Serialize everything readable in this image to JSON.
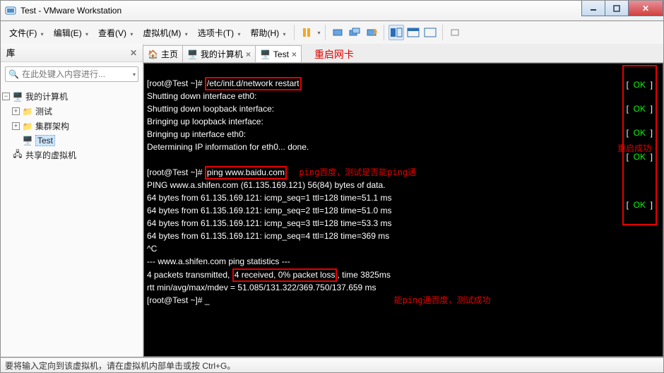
{
  "title": "Test - VMware Workstation",
  "menu": {
    "file": "文件(F)",
    "edit": "编辑(E)",
    "view": "查看(V)",
    "vm": "虚拟机(M)",
    "tabs": "选项卡(T)",
    "help": "帮助(H)"
  },
  "sidebar": {
    "header": "库",
    "search_placeholder": "在此处键入内容进行...",
    "root": "我的计算机",
    "items": [
      "测试",
      "集群架构",
      "Test"
    ],
    "shared": "共享的虚拟机"
  },
  "tabs": {
    "home": "主页",
    "mypc": "我的计算机",
    "test": "Test"
  },
  "annot": {
    "restart_nic": "重启网卡",
    "ping_test": "ping百度，测试是否能ping通",
    "restart_ok": "重启成功",
    "ping_ok": "能ping通百度，测试成功"
  },
  "ok": "OK",
  "term": {
    "prompt1": "[root@Test ~]# ",
    "cmd1": "/etc/init.d/network restart",
    "l1": "Shutting down interface eth0:",
    "l2": "Shutting down loopback interface:",
    "l3": "Bringing up loopback interface:",
    "l4": "Bringing up interface eth0:",
    "l5": "Determining IP information for eth0... done.",
    "cmd2": "ping www.baidu.com",
    "p0": "PING www.a.shifen.com (61.135.169.121) 56(84) bytes of data.",
    "p1": "64 bytes from 61.135.169.121: icmp_seq=1 ttl=128 time=51.1 ms",
    "p2": "64 bytes from 61.135.169.121: icmp_seq=2 ttl=128 time=51.0 ms",
    "p3": "64 bytes from 61.135.169.121: icmp_seq=3 ttl=128 time=53.3 ms",
    "p4": "64 bytes from 61.135.169.121: icmp_seq=4 ttl=128 time=369 ms",
    "ctrlc": "^C",
    "s1": "--- www.a.shifen.com ping statistics ---",
    "s2a": "4 packets transmitted, ",
    "s2b": "4 received, 0% packet loss",
    "s2c": ", time 3825ms",
    "s3": "rtt min/avg/max/mdev = 51.085/131.322/369.750/137.659 ms",
    "prompt3": "[root@Test ~]# ",
    "cursor": "_"
  },
  "status": "要将输入定向到该虚拟机，请在虚拟机内部单击或按 Ctrl+G。"
}
